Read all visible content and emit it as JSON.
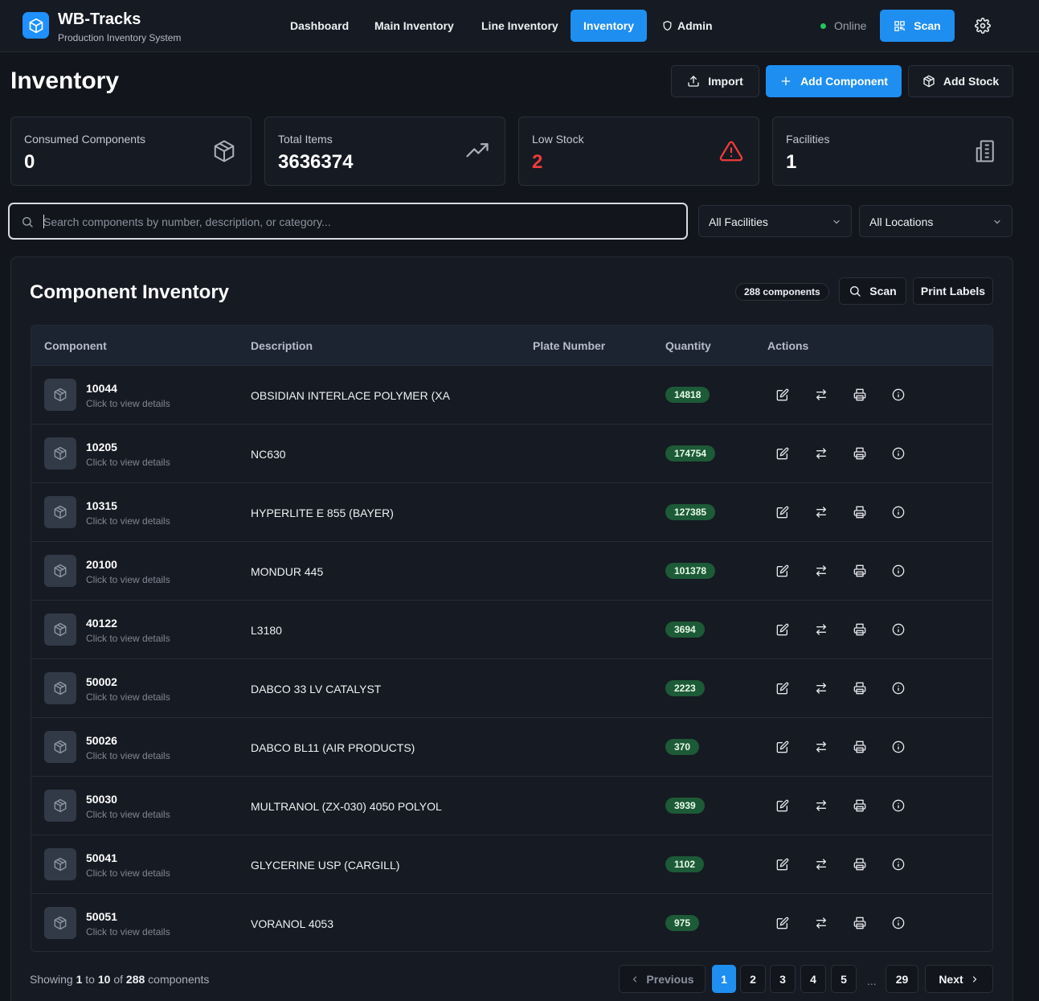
{
  "header": {
    "app_name": "WB-Tracks",
    "app_subtitle": "Production Inventory System",
    "nav": [
      {
        "label": "Dashboard"
      },
      {
        "label": "Main Inventory"
      },
      {
        "label": "Line Inventory"
      },
      {
        "label": "Inventory",
        "active": true
      },
      {
        "label": "Admin",
        "icon": "shield-icon"
      }
    ],
    "status": "Online",
    "status_color": "#22c55e",
    "scan_label": "Scan",
    "accent_color": "#1f8ef1"
  },
  "page": {
    "title": "Inventory",
    "actions": {
      "import_label": "Import",
      "add_component_label": "Add Component",
      "add_stock_label": "Add Stock"
    }
  },
  "stats": [
    {
      "label": "Consumed Components",
      "value": "0",
      "icon": "package-icon"
    },
    {
      "label": "Total Items",
      "value": "3636374",
      "icon": "trending-up-icon"
    },
    {
      "label": "Low Stock",
      "value": "2",
      "icon": "alert-triangle-icon",
      "color": "#ef3b3b"
    },
    {
      "label": "Facilities",
      "value": "1",
      "icon": "building-icon"
    }
  ],
  "filters": {
    "search_placeholder": "Search components by number, description, or category...",
    "facility": "All Facilities",
    "location": "All Locations"
  },
  "inventory": {
    "title": "Component Inventory",
    "count_badge": "288 components",
    "scan_label": "Scan",
    "print_labels": "Print Labels",
    "columns": [
      "Component",
      "Description",
      "Plate Number",
      "Quantity",
      "Actions"
    ],
    "row_hint": "Click to view details",
    "rows": [
      {
        "number": "10044",
        "description": "OBSIDIAN INTERLACE POLYMER (XA",
        "plate": "",
        "quantity": "14818"
      },
      {
        "number": "10205",
        "description": "NC630",
        "plate": "",
        "quantity": "174754"
      },
      {
        "number": "10315",
        "description": "HYPERLITE E 855 (BAYER)",
        "plate": "",
        "quantity": "127385"
      },
      {
        "number": "20100",
        "description": "MONDUR 445",
        "plate": "",
        "quantity": "101378"
      },
      {
        "number": "40122",
        "description": "L3180",
        "plate": "",
        "quantity": "3694"
      },
      {
        "number": "50002",
        "description": "DABCO 33 LV CATALYST",
        "plate": "",
        "quantity": "2223"
      },
      {
        "number": "50026",
        "description": "DABCO BL11 (AIR PRODUCTS)",
        "plate": "",
        "quantity": "370"
      },
      {
        "number": "50030",
        "description": "MULTRANOL (ZX-030) 4050 POLYOL",
        "plate": "",
        "quantity": "3939"
      },
      {
        "number": "50041",
        "description": "GLYCERINE USP (CARGILL)",
        "plate": "",
        "quantity": "1102"
      },
      {
        "number": "50051",
        "description": "VORANOL 4053",
        "plate": "",
        "quantity": "975"
      }
    ],
    "quantity_badge_color": "#1d5a37"
  },
  "pagination": {
    "showing_prefix": "Showing",
    "from": "1",
    "to_word": "to",
    "to": "10",
    "of_word": "of",
    "total": "288",
    "suffix": "components",
    "previous": "Previous",
    "next": "Next",
    "pages": [
      "1",
      "2",
      "3",
      "4",
      "5"
    ],
    "ellipsis": "...",
    "last_page": "29",
    "current_page": "1"
  }
}
